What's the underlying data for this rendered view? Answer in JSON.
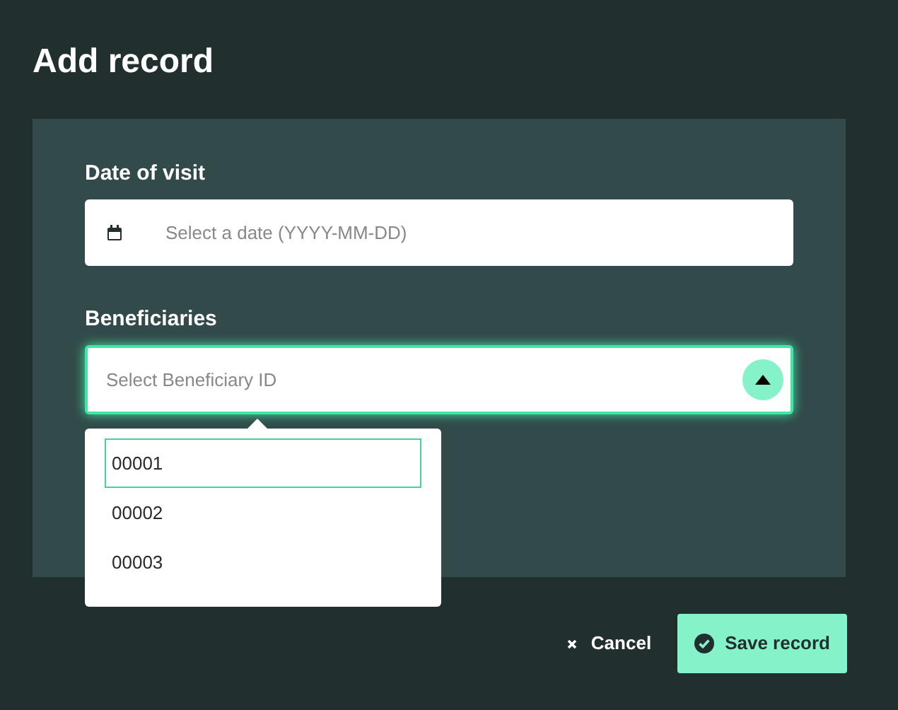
{
  "title": "Add record",
  "date_field": {
    "label": "Date of visit",
    "placeholder": "Select a date (YYYY-MM-DD)"
  },
  "beneficiary_select": {
    "label": "Beneficiaries",
    "placeholder": "Select Beneficiary ID",
    "expanded": true,
    "options": [
      {
        "label": "00001",
        "selected": true
      },
      {
        "label": "00002",
        "selected": false
      },
      {
        "label": "00003",
        "selected": false
      }
    ]
  },
  "buttons": [
    {
      "kind": "secondary",
      "label": "Cancel"
    },
    {
      "kind": "primary",
      "label": "Save record"
    }
  ]
}
